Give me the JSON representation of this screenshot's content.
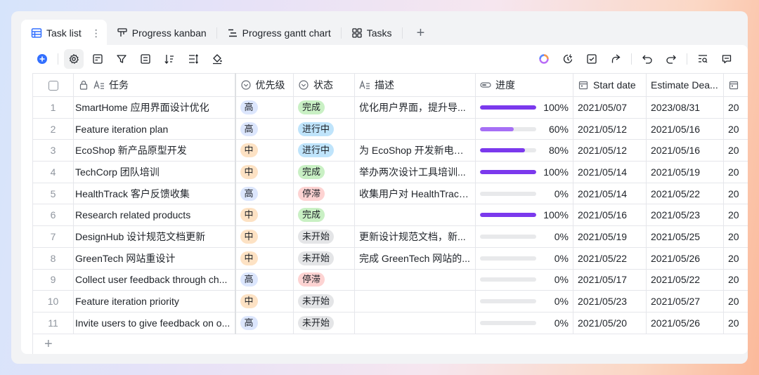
{
  "tabs": [
    {
      "label": "Task list",
      "icon": "grid-table-icon",
      "active": true
    },
    {
      "label": "Progress kanban",
      "icon": "kanban-icon",
      "active": false
    },
    {
      "label": "Progress gantt chart",
      "icon": "gantt-icon",
      "active": false
    },
    {
      "label": "Tasks",
      "icon": "gallery-icon",
      "active": false
    }
  ],
  "colors": {
    "accent": "#3370ff",
    "progress": "#7b39ed"
  },
  "columns": {
    "name": "任务",
    "priority": "优先级",
    "status": "状态",
    "description": "描述",
    "progress": "进度",
    "start_date": "Start date",
    "estimate_deadline": "Estimate Dea...",
    "extra": ""
  },
  "rows": [
    {
      "idx": "1",
      "name": "SmartHome 应用界面设计优化",
      "priority": "高",
      "status": "完成",
      "status_kind": "done",
      "description": "优化用户界面，提升导...",
      "progress": 1.0,
      "progress_label": "100%",
      "start": "2021/05/07",
      "deadline": "2023/08/31",
      "extra": "20"
    },
    {
      "idx": "2",
      "name": "Feature iteration plan",
      "priority": "高",
      "status": "进行中",
      "status_kind": "prog",
      "description": "",
      "progress": 0.6,
      "progress_label": "60%",
      "start": "2021/05/12",
      "deadline": "2021/05/16",
      "extra": "20"
    },
    {
      "idx": "3",
      "name": "EcoShop 新产品原型开发",
      "priority": "中",
      "status": "进行中",
      "status_kind": "prog",
      "description": "为 EcoShop 开发新电商...",
      "progress": 0.8,
      "progress_label": "80%",
      "start": "2021/05/12",
      "deadline": "2021/05/16",
      "extra": "20"
    },
    {
      "idx": "4",
      "name": "TechCorp 团队培训",
      "priority": "中",
      "status": "完成",
      "status_kind": "done",
      "description": "举办两次设计工具培训...",
      "progress": 1.0,
      "progress_label": "100%",
      "start": "2021/05/14",
      "deadline": "2021/05/19",
      "extra": "20"
    },
    {
      "idx": "5",
      "name": "HealthTrack 客户反馈收集",
      "priority": "高",
      "status": "停滞",
      "status_kind": "stuck",
      "description": "收集用户对 HealthTrack...",
      "progress": 0,
      "progress_label": "0%",
      "start": "2021/05/14",
      "deadline": "2021/05/22",
      "extra": "20"
    },
    {
      "idx": "6",
      "name": "Research related products",
      "priority": "中",
      "status": "完成",
      "status_kind": "done",
      "description": "",
      "progress": 1.0,
      "progress_label": "100%",
      "start": "2021/05/16",
      "deadline": "2021/05/23",
      "extra": "20"
    },
    {
      "idx": "7",
      "name": "DesignHub 设计规范文档更新",
      "priority": "中",
      "status": "未开始",
      "status_kind": "todo",
      "description": "更新设计规范文档，新...",
      "progress": 0,
      "progress_label": "0%",
      "start": "2021/05/19",
      "deadline": "2021/05/25",
      "extra": "20"
    },
    {
      "idx": "8",
      "name": "GreenTech 网站重设计",
      "priority": "中",
      "status": "未开始",
      "status_kind": "todo",
      "description": "完成 GreenTech 网站的...",
      "progress": 0,
      "progress_label": "0%",
      "start": "2021/05/22",
      "deadline": "2021/05/26",
      "extra": "20"
    },
    {
      "idx": "9",
      "name": "Collect user feedback through ch...",
      "priority": "高",
      "status": "停滞",
      "status_kind": "stuck",
      "description": "",
      "progress": 0,
      "progress_label": "0%",
      "start": "2021/05/17",
      "deadline": "2021/05/22",
      "extra": "20"
    },
    {
      "idx": "10",
      "name": "Feature iteration priority",
      "priority": "中",
      "status": "未开始",
      "status_kind": "todo",
      "description": "",
      "progress": 0,
      "progress_label": "0%",
      "start": "2021/05/23",
      "deadline": "2021/05/27",
      "extra": "20"
    },
    {
      "idx": "11",
      "name": "Invite users to give feedback on o...",
      "priority": "高",
      "status": "未开始",
      "status_kind": "todo",
      "description": "",
      "progress": 0,
      "progress_label": "0%",
      "start": "2021/05/20",
      "deadline": "2021/05/26",
      "extra": "20"
    }
  ],
  "add_row_label": "+"
}
